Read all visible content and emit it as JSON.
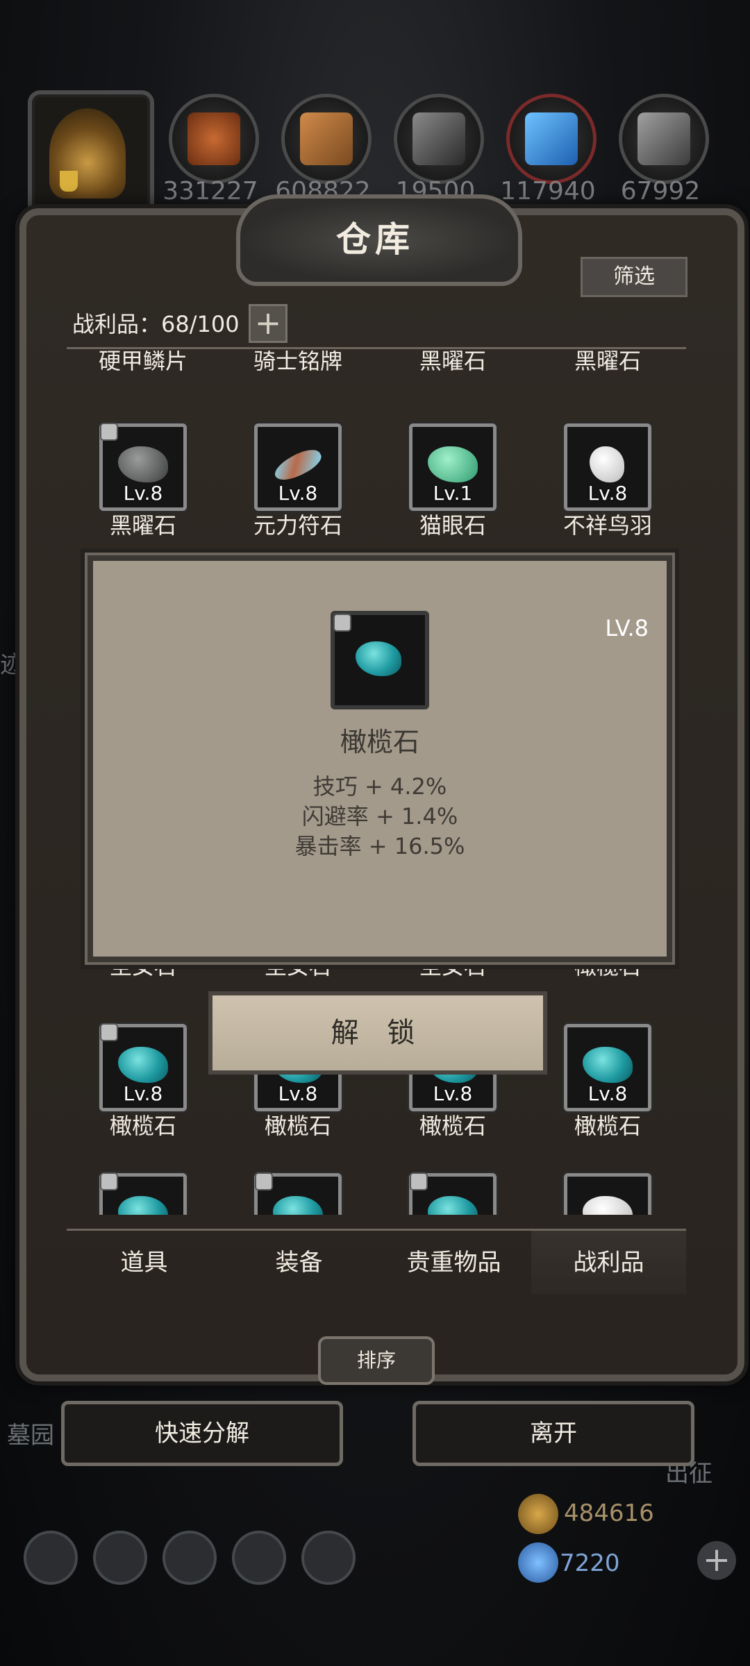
{
  "resources": [
    {
      "icon": "leather-icon",
      "value": "331227"
    },
    {
      "icon": "wood-icon",
      "value": "608822"
    },
    {
      "icon": "iron-ingot-icon",
      "value": "19500"
    },
    {
      "icon": "crystal-icon",
      "value": "117940"
    },
    {
      "icon": "steel-ingot-icon",
      "value": "67992"
    }
  ],
  "panel": {
    "title": "仓库",
    "filter_label": "筛选",
    "count_label": "战利品：68/100",
    "plus": "+"
  },
  "grid": {
    "top_row_names": [
      "硬甲鳞片",
      "骑士铭牌",
      "黑曜石",
      "黑曜石"
    ],
    "row1": [
      {
        "level": "Lv.8",
        "name": "黑曜石",
        "locked": true,
        "color": "#5d605f"
      },
      {
        "level": "Lv.8",
        "name": "元力符石",
        "locked": false,
        "color": "#b86a4a"
      },
      {
        "level": "Lv.1",
        "name": "猫眼石",
        "locked": false,
        "color": "#3fb98e"
      },
      {
        "level": "Lv.8",
        "name": "不祥鸟羽",
        "locked": false,
        "color": "#ececec"
      }
    ],
    "hidden_row_names": [
      "圣女石",
      "圣女石",
      "圣女石",
      "橄榄石"
    ],
    "row3": [
      {
        "level": "Lv.8",
        "name": "橄榄石",
        "locked": true
      },
      {
        "level": "Lv.8",
        "name": "橄榄石",
        "locked": false
      },
      {
        "level": "Lv.8",
        "name": "橄榄石",
        "locked": false
      },
      {
        "level": "Lv.8",
        "name": "橄榄石",
        "locked": false
      }
    ]
  },
  "tooltip": {
    "level": "LV.8",
    "name": "橄榄石",
    "stats": [
      "技巧 + 4.2%",
      "闪避率 + 1.4%",
      "暴击率 + 16.5%"
    ],
    "unlock_label": "解 锁"
  },
  "tabs": [
    "道具",
    "装备",
    "贵重物品",
    "战利品"
  ],
  "active_tab": "战利品",
  "sort_label": "排序",
  "actions": {
    "decompose": "快速分解",
    "leave": "离开"
  },
  "background": {
    "left1": "迹",
    "left2": "墓园",
    "right": "出征"
  },
  "currency": [
    {
      "icon": "scroll-icon",
      "value": "484616"
    },
    {
      "icon": "gem-icon",
      "value": "7220"
    }
  ],
  "colors": {
    "olivine": "#1f9aa1",
    "accent": "#a8916a"
  }
}
